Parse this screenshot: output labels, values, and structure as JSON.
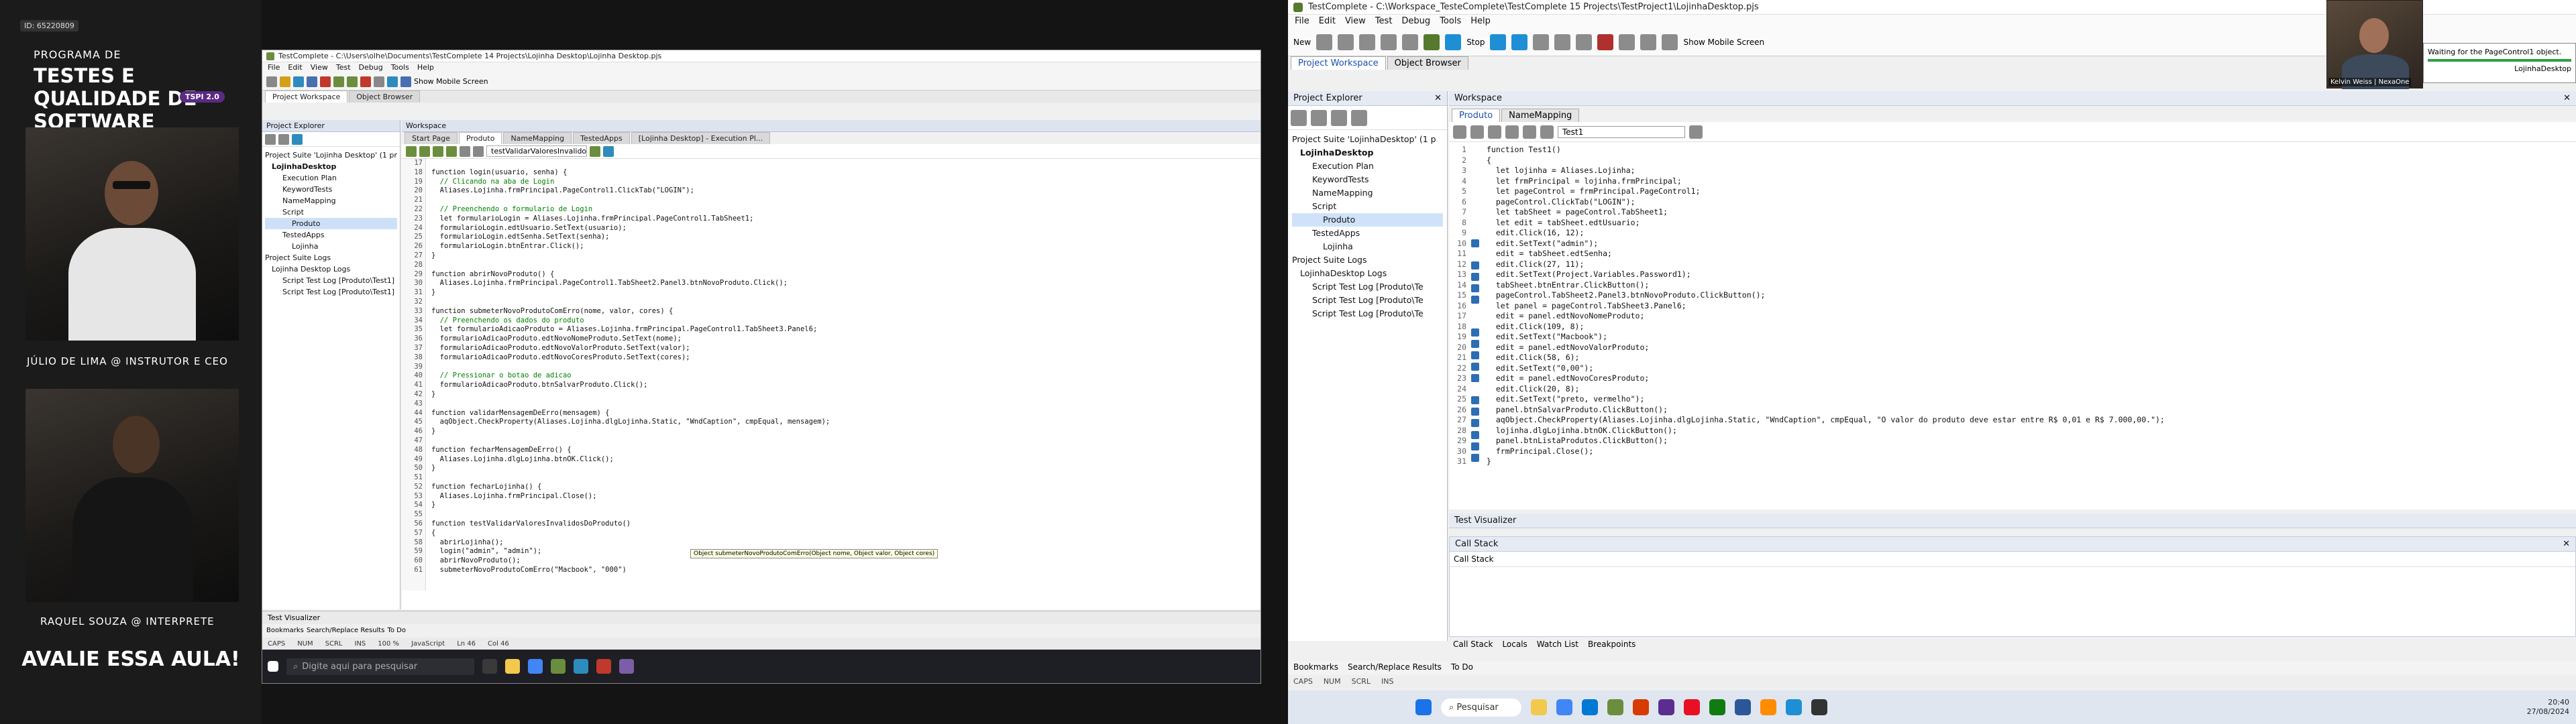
{
  "broadcast": {
    "badge": "ID: 65220809",
    "program_label": "PROGRAMA DE",
    "program_title": "TESTES E QUALIDADE DE SOFTWARE",
    "program_tag": "TSPI 2.0",
    "host_name": "JÚLIO DE LIMA @ INSTRUTOR E CEO",
    "interpreter_name": "RAQUEL SOUZA @ INTERPRETE",
    "cta": "AVALIE ESSA AULA!"
  },
  "left_window": {
    "title": "TestComplete - C:\\Users\\olhe\\Documents\\TestComplete 14 Projects\\Lojinha Desktop\\Lojinha Desktop.pjs",
    "menu": [
      "File",
      "Edit",
      "View",
      "Test",
      "Debug",
      "Tools",
      "Help"
    ],
    "toolbar_text": "Show Mobile Screen",
    "sub_tabs": [
      "Project Workspace",
      "Object Browser"
    ],
    "explorer_title": "Project Explorer",
    "workspace_title": "Workspace",
    "editor_tabs": [
      "Start Page",
      "Produto",
      "NameMapping",
      "TestedApps",
      "[Lojinha Desktop] - Execution Pl..."
    ],
    "routine_selector": "testValidarValoresInvalidosDoP",
    "tree": [
      "Project Suite 'Lojinha Desktop' (1 project)",
      "LojinhaDesktop",
      "Execution Plan",
      "KeywordTests",
      "NameMapping",
      "Script",
      "Produto",
      "TestedApps",
      "Lojinha",
      "Project Suite Logs",
      "Lojinha Desktop Logs",
      "Script Test Log [Produto\\Test1]",
      "Script Test Log [Produto\\Test1]"
    ],
    "code_start_line": 17,
    "code": [
      "",
      "function login(usuario, senha) {",
      "  // Clicando na aba de Login",
      "  Aliases.Lojinha.frmPrincipal.PageControl1.ClickTab(\"LOGIN\");",
      "",
      "  // Preenchendo o formulario de Login",
      "  let formularioLogin = Aliases.Lojinha.frmPrincipal.PageControl1.TabSheet1;",
      "  formularioLogin.edtUsuario.SetText(usuario);",
      "  formularioLogin.edtSenha.SetText(senha);",
      "  formularioLogin.btnEntrar.Click();",
      "}",
      "",
      "function abrirNovoProduto() {",
      "  Aliases.Lojinha.frmPrincipal.PageControl1.TabSheet2.Panel3.btnNovoProduto.Click();",
      "}",
      "",
      "function submeterNovoProdutoComErro(nome, valor, cores) {",
      "  // Preenchendo os dados do produto",
      "  let formularioAdicaoProduto = Aliases.Lojinha.frmPrincipal.PageControl1.TabSheet3.Panel6;",
      "  formularioAdicaoProduto.edtNovoNomeProduto.SetText(nome);",
      "  formularioAdicaoProduto.edtNovoValorProduto.SetText(valor);",
      "  formularioAdicaoProduto.edtNovoCoresProduto.SetText(cores);",
      "",
      "  // Pressionar o botao de adicao",
      "  formularioAdicaoProduto.btnSalvarProduto.Click();",
      "}",
      "",
      "function validarMensagemDeErro(mensagem) {",
      "  aqObject.CheckProperty(Aliases.Lojinha.dlgLojinha.Static, \"WndCaption\", cmpEqual, mensagem);",
      "}",
      "",
      "function fecharMensagemDeErro() {",
      "  Aliases.Lojinha.dlgLojinha.btnOK.Click();",
      "}",
      "",
      "function fecharLojinha() {",
      "  Aliases.Lojinha.frmPrincipal.Close();",
      "}",
      "",
      "function testValidarValoresInvalidosDoProduto()",
      "{",
      "  abrirLojinha();",
      "  login(\"admin\", \"admin\");",
      "  abrirNovoProduto();",
      "  submeterNovoProdutoComErro(\"Macbook\", \"000\")"
    ],
    "tooltip": "Object submeterNovoProdutoComErro(Object nome, Object valor, Object cores)",
    "bottom_panel": "Test Visualizer",
    "bottom_tabs": [
      "Bookmarks",
      "Search/Replace Results",
      "To Do"
    ],
    "status": [
      "CAPS",
      "NUM",
      "SCRL",
      "INS",
      "100 %",
      "JavaScript",
      "Ln 46",
      "Col 46"
    ],
    "taskbar_search": "Digite aqui para pesquisar"
  },
  "right_window": {
    "title": "TestComplete - C:\\Workspace_TesteComplete\\TestComplete 15 Projects\\TestProject1\\LojinhaDesktop.pjs",
    "menu": [
      "File",
      "Edit",
      "View",
      "Test",
      "Debug",
      "Tools",
      "Help"
    ],
    "toolbar": {
      "new": "New",
      "stop": "Stop",
      "show_mobile": "Show Mobile Screen"
    },
    "sub_tabs": [
      "Project Workspace",
      "Object Browser"
    ],
    "explorer_title": "Project Explorer",
    "workspace_title": "Workspace",
    "editor_tabs": [
      "Produto",
      "NameMapping"
    ],
    "routine_selector": "Test1",
    "tree": [
      "Project Suite 'LojinhaDesktop' (1 p",
      "LojinhaDesktop",
      "Execution Plan",
      "KeywordTests",
      "NameMapping",
      "Script",
      "Produto",
      "TestedApps",
      "Lojinha",
      "Project Suite Logs",
      "LojinhaDesktop Logs",
      "Script Test Log [Produto\\Te",
      "Script Test Log [Produto\\Te",
      "Script Test Log [Produto\\Te"
    ],
    "code": [
      "function Test1()",
      "{",
      "  let lojinha = Aliases.Lojinha;",
      "  let frmPrincipal = lojinha.frmPrincipal;",
      "  let pageControl = frmPrincipal.PageControl1;",
      "  pageControl.ClickTab(\"LOGIN\");",
      "  let tabSheet = pageControl.TabSheet1;",
      "  let edit = tabSheet.edtUsuario;",
      "  edit.Click(16, 12);",
      "  edit.SetText(\"admin\");",
      "  edit = tabSheet.edtSenha;",
      "  edit.Click(27, 11);",
      "  edit.SetText(Project.Variables.Password1);",
      "  tabSheet.btnEntrar.ClickButton();",
      "  pageControl.TabSheet2.Panel3.btnNovoProduto.ClickButton();",
      "  let panel = pageControl.TabSheet3.Panel6;",
      "  edit = panel.edtNovoNomeProduto;",
      "  edit.Click(109, 8);",
      "  edit.SetText(\"Macbook\");",
      "  edit = panel.edtNovoValorProduto;",
      "  edit.Click(58, 6);",
      "  edit.SetText(\"0,00\");",
      "  edit = panel.edtNovoCoresProduto;",
      "  edit.Click(20, 8);",
      "  edit.SetText(\"preto, vermelho\");",
      "  panel.btnSalvarProduto.ClickButton();",
      "  aqObject.CheckProperty(Aliases.Lojinha.dlgLojinha.Static, \"WndCaption\", cmpEqual, \"O valor do produto deve estar entre R$ 0,01 e R$ 7.000,00.\");",
      "  lojinha.dlgLojinha.btnOK.ClickButton();",
      "  panel.btnListaProdutos.ClickButton();",
      "  frmPrincipal.Close();",
      "}"
    ],
    "test_visualizer": "Test Visualizer",
    "call_stack_title": "Call Stack",
    "call_stack_header": "Call Stack",
    "lower_tabs": [
      "Call Stack",
      "Locals",
      "Watch List",
      "Breakpoints"
    ],
    "bottom_tabs": [
      "Bookmarks",
      "Search/Replace Results",
      "To Do"
    ],
    "status": [
      "CAPS",
      "NUM",
      "SCRL",
      "INS"
    ],
    "overlay_name": "Kelvin Weiss | NexaOne",
    "waiting_msg": "Waiting for the PageControl1 object.",
    "waiting_sub": "LojinhaDesktop",
    "taskbar_search": "Pesquisar",
    "clock_time": "20:40",
    "clock_date": "27/08/2024"
  }
}
